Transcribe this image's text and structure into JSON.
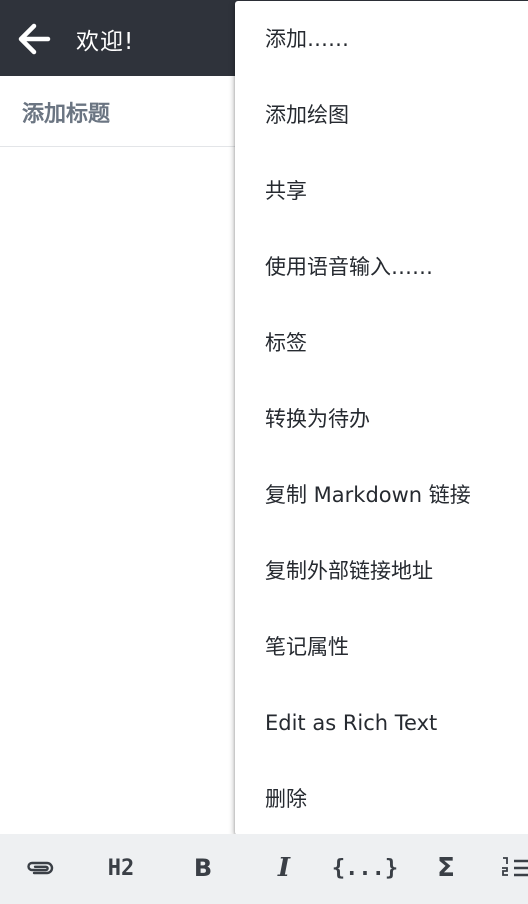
{
  "appbar": {
    "title": "欢迎!",
    "back_icon": "arrow-left-icon"
  },
  "note": {
    "title_placeholder": "添加标题"
  },
  "menu": {
    "items": [
      {
        "label": "添加……"
      },
      {
        "label": "添加绘图"
      },
      {
        "label": "共享"
      },
      {
        "label": "使用语音输入……"
      },
      {
        "label": "标签"
      },
      {
        "label": "转换为待办"
      },
      {
        "label": "复制 Markdown 链接"
      },
      {
        "label": "复制外部链接地址"
      },
      {
        "label": "笔记属性"
      },
      {
        "label": "Edit as Rich Text"
      },
      {
        "label": "删除"
      }
    ]
  },
  "toolbar": {
    "attach_icon": "paperclip-icon",
    "heading_label": "H2",
    "bold_label": "B",
    "italic_label": "I",
    "code_label": "{...}",
    "math_label": "Σ",
    "list_icon": "numbered-list-icon"
  },
  "colors": {
    "appbar_bg": "#2f333b",
    "toolbar_bg": "#eef0f2",
    "placeholder_text": "#6b7582"
  }
}
